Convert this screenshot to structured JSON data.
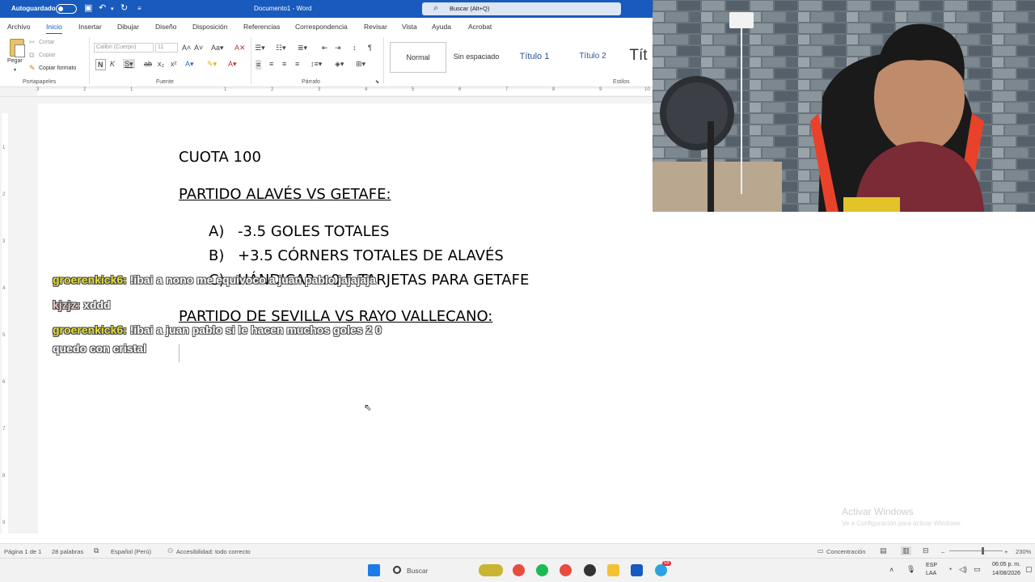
{
  "titlebar": {
    "autosave_label": "Autoguardado",
    "doc_title": "Documento1 - Word",
    "search_placeholder": "Buscar (Alt+Q)"
  },
  "ribbon": {
    "tabs": [
      "Archivo",
      "Inicio",
      "Insertar",
      "Dibujar",
      "Diseño",
      "Disposición",
      "Referencias",
      "Correspondencia",
      "Revisar",
      "Vista",
      "Ayuda",
      "Acrobat"
    ],
    "clipboard": {
      "paste": "Pegar",
      "cut": "Cortar",
      "copy": "Copiar",
      "format_painter": "Copiar formato",
      "group": "Portapapeles"
    },
    "font": {
      "name": "Calibri (Cuerpo)",
      "size": "11",
      "group": "Fuente"
    },
    "paragraph": {
      "group": "Párrafo"
    },
    "styles": {
      "items": [
        "Normal",
        "Sin espaciado",
        "Título 1",
        "Título 2",
        "Tít"
      ],
      "group": "Estilos"
    }
  },
  "ruler": {
    "numbers": [
      "3",
      "2",
      "1",
      "1",
      "2",
      "3",
      "4",
      "5",
      "6",
      "7",
      "8",
      "9",
      "10"
    ]
  },
  "vruler": {
    "numbers": [
      "1",
      "2",
      "3",
      "4",
      "5",
      "6",
      "7",
      "8",
      "9"
    ]
  },
  "document": {
    "line1": "CUOTA 100",
    "heading1": "PARTIDO ALAVÉS VS GETAFE:",
    "opt_a_letter": "A)",
    "opt_a": "-3.5 GOLES TOTALES",
    "opt_b_letter": "B)",
    "opt_b": "+3.5 CÓRNERS TOTALES DE ALAVÉS",
    "opt_c_letter": "C)",
    "opt_c": "HÁNDICAP +0.5 TARJETAS PARA GETAFE",
    "heading2": "PARTIDO DE SEVILLA VS RAYO VALLECANO:"
  },
  "chat": [
    {
      "user": "groerenkick6:",
      "message": "!ibai a nono me equivoco a juan pablo jajajaja"
    },
    {
      "user": "kjzjz:",
      "message": "xddd"
    },
    {
      "user": "groerenkick6:",
      "message": "!ibai a juan pablo si le hacen muchos goles 2 0",
      "continuation": "quedo con cristal"
    }
  ],
  "watermark": {
    "title": "Activar Windows",
    "subtitle": "Ve a Configuración para activar Windows."
  },
  "statusbar": {
    "page": "Página 1 de 1",
    "words": "28 palabras",
    "language": "Español (Perú)",
    "accessibility": "Accesibilidad: todo correcto",
    "focus": "Concentración",
    "zoom": "230%"
  },
  "taskbar": {
    "search": "Buscar",
    "lang_top": "ESP",
    "lang_bottom": "LAA",
    "time": "06:05 p. m.",
    "date": "14/08/2026",
    "telegram_badge": "58"
  },
  "colors": {
    "word_blue": "#185abd",
    "chat_user": "#e6e13a"
  }
}
